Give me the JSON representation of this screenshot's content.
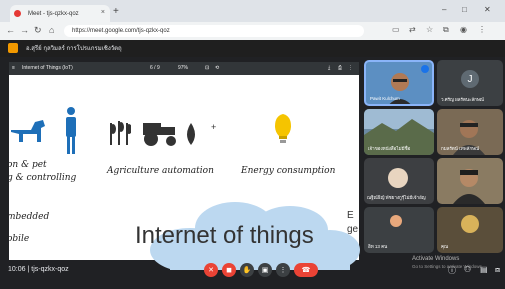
{
  "browser": {
    "tab_title": "Meet - tjs-qzkx-qoz",
    "new_tab": "+",
    "url": "https://meet.google.com/tjs-qzkx-qoz",
    "window_controls": [
      "–",
      "□",
      "✕"
    ],
    "nav_icons": [
      "back-icon",
      "forward-icon",
      "reload-icon",
      "home-icon"
    ]
  },
  "meet": {
    "header_title": "อ.สุรีย์ กุลวิมลร์ การโปรแกรมเชิงวัตถุ",
    "meeting_code": "tjs-qzkx-qoz",
    "time": "10:06",
    "separator": "|",
    "accent": "#ea4335"
  },
  "presentation": {
    "doc_title": "Internet of Things (IoT)",
    "page": "6 / 9",
    "zoom": "97%",
    "slide": {
      "items": [
        {
          "line1": "on & pet",
          "line2": "g & controlling"
        },
        {
          "line1": "Agriculture automation"
        },
        {
          "line1": "Energy consumption"
        }
      ],
      "left_lines": [
        "mbedded",
        "obile"
      ],
      "right_partial": [
        "E",
        "ge"
      ],
      "big_title": "Internet of things",
      "glyphs": {
        "droplet_minus": "-",
        "plus": "+"
      }
    }
  },
  "participants": [
    {
      "name": "Pawit Kulchum",
      "letter": "",
      "color": "#5c8fc2"
    },
    {
      "name": "ว.ศรัญ ผลรัตนะลักษณ์",
      "letter": "J",
      "color": "#5f6a72"
    },
    {
      "name": "เจ้าของหนังสือไม่มีชื่อ",
      "letter": "",
      "color": "#6b8aa3"
    },
    {
      "name": "กมลรัตน์ เทพลักษณ์",
      "letter": "",
      "color": "#7a6a55"
    },
    {
      "name": "ณฐิณ์ธิญ์ พัชยางกูรุ์ไม่มีเจ้าอัญ",
      "letter": "",
      "color": "#3d3f42"
    },
    {
      "name": "",
      "letter": "",
      "color": "#8a7b62"
    },
    {
      "name": "อิท 13 คน",
      "letter": "",
      "color": "#3c4043"
    },
    {
      "name": "คุณ",
      "letter": "",
      "color": "#5a4e3a"
    }
  ],
  "controls": {
    "mic": "mic-off-icon",
    "cam": "camera-off-icon",
    "hand": "raise-hand-icon",
    "present": "present-icon",
    "more": "more-options-icon",
    "leave": "leave-call-icon"
  },
  "watermark": {
    "line1": "Activate Windows",
    "line2": "Go to Settings to activate Windows."
  }
}
